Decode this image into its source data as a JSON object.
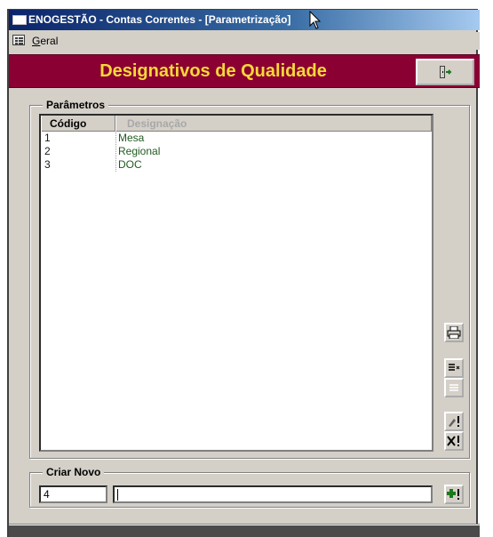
{
  "window": {
    "title": "ENOGESTÃO - Contas Correntes - [Parametrização]"
  },
  "menu": {
    "geral_first": "G",
    "geral_rest": "eral"
  },
  "header": {
    "title": "Designativos de Qualidade",
    "title_color": "#f7d838",
    "band_color": "#8b0033"
  },
  "parametros": {
    "legend": "Parâmetros",
    "columns": {
      "codigo": "Código",
      "designacao": "Designação"
    },
    "rows": [
      {
        "codigo": "1",
        "designacao": "Mesa"
      },
      {
        "codigo": "2",
        "designacao": "Regional"
      },
      {
        "codigo": "3",
        "designacao": "DOC"
      }
    ]
  },
  "criar_novo": {
    "legend": "Criar Novo",
    "codigo_value": "4",
    "designacao_value": ""
  },
  "icons": {
    "exit": "exit-door-icon",
    "print": "printer-icon",
    "add": "add-plus-icon"
  }
}
